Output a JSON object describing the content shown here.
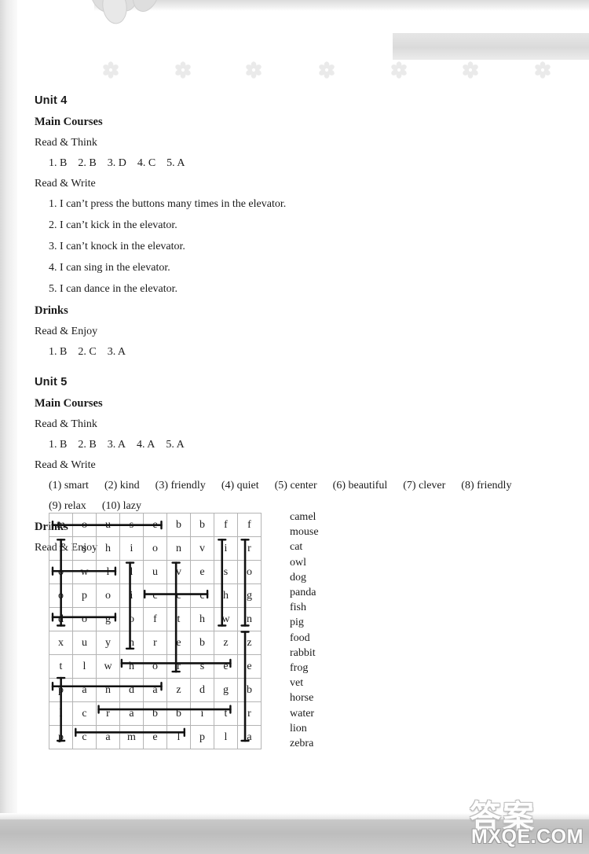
{
  "units": [
    {
      "title": "Unit 4",
      "sections": [
        {
          "kind": "section-head",
          "text": "Main Courses"
        },
        {
          "kind": "sub-head",
          "text": "Read & Think"
        },
        {
          "kind": "answers",
          "tokens": [
            "1. B",
            "2. B",
            "3. D",
            "4. C",
            "5. A"
          ]
        },
        {
          "kind": "sub-head",
          "text": "Read & Write"
        },
        {
          "kind": "sentence",
          "text": "1. I can’t press the buttons many times in the elevator."
        },
        {
          "kind": "sentence",
          "text": "2. I can’t kick in the elevator."
        },
        {
          "kind": "sentence",
          "text": "3. I can’t knock in the elevator."
        },
        {
          "kind": "sentence",
          "text": "4. I can sing in the elevator."
        },
        {
          "kind": "sentence",
          "text": "5. I can dance in the elevator."
        },
        {
          "kind": "section-head",
          "text": "Drinks"
        },
        {
          "kind": "sub-head",
          "text": "Read & Enjoy"
        },
        {
          "kind": "answers",
          "tokens": [
            "1. B",
            "2. C",
            "3. A"
          ]
        }
      ]
    },
    {
      "title": "Unit 5",
      "sections": [
        {
          "kind": "section-head",
          "text": "Main Courses"
        },
        {
          "kind": "sub-head",
          "text": "Read & Think"
        },
        {
          "kind": "answers",
          "tokens": [
            "1. B",
            "2. B",
            "3. A",
            "4. A",
            "5. A"
          ]
        },
        {
          "kind": "sub-head",
          "text": "Read & Write"
        },
        {
          "kind": "answers-wide",
          "tokens": [
            "(1) smart",
            "(2) kind",
            "(3) friendly",
            "(4) quiet",
            "(5) center",
            "(6) beautiful",
            "(7) clever",
            "(8) friendly"
          ]
        },
        {
          "kind": "answers-wide",
          "tokens": [
            "(9) relax",
            "(10) lazy"
          ]
        },
        {
          "kind": "section-head",
          "text": "Drinks"
        },
        {
          "kind": "sub-head",
          "text": "Read & Enjoy"
        }
      ]
    }
  ],
  "puzzle": {
    "rows": 10,
    "cols": 9,
    "grid": [
      [
        "m",
        "o",
        "u",
        "s",
        "e",
        "b",
        "b",
        "f",
        "f"
      ],
      [
        "f",
        "s",
        "h",
        "i",
        "o",
        "n",
        "v",
        "i",
        "r"
      ],
      [
        "o",
        "w",
        "l",
        "l",
        "u",
        "v",
        "e",
        "s",
        "o"
      ],
      [
        "o",
        "p",
        "o",
        "i",
        "c",
        "c",
        "c",
        "h",
        "g"
      ],
      [
        "d",
        "o",
        "g",
        "o",
        "f",
        "t",
        "h",
        "w",
        "n"
      ],
      [
        "x",
        "u",
        "y",
        "n",
        "r",
        "e",
        "b",
        "z",
        "z"
      ],
      [
        "t",
        "l",
        "w",
        "h",
        "o",
        "r",
        "s",
        "e",
        "e"
      ],
      [
        "p",
        "a",
        "n",
        "d",
        "a",
        "z",
        "d",
        "g",
        "b"
      ],
      [
        "l",
        "c",
        "r",
        "a",
        "b",
        "b",
        "i",
        "t",
        "r"
      ],
      [
        "p",
        "c",
        "a",
        "m",
        "e",
        "l",
        "p",
        "l",
        "a"
      ]
    ],
    "found_words": [
      {
        "word": "mouse",
        "row": 0,
        "col": 0,
        "dir": "h",
        "len": 5
      },
      {
        "word": "fish",
        "row": 1,
        "col": 7,
        "dir": "v",
        "len": 4
      },
      {
        "word": "frog",
        "row": 1,
        "col": 8,
        "dir": "v",
        "len": 4
      },
      {
        "word": "owl",
        "row": 2,
        "col": 0,
        "dir": "h",
        "len": 3
      },
      {
        "word": "food",
        "row": 1,
        "col": 0,
        "dir": "v",
        "len": 4
      },
      {
        "word": "cat",
        "row": 3,
        "col": 4,
        "dir": "h",
        "len": 3
      },
      {
        "word": "dog",
        "row": 4,
        "col": 0,
        "dir": "h",
        "len": 3
      },
      {
        "word": "lion",
        "row": 2,
        "col": 3,
        "dir": "v",
        "len": 4
      },
      {
        "word": "vet",
        "row": 2,
        "col": 5,
        "dir": "v",
        "len": 5
      },
      {
        "word": "horse",
        "row": 6,
        "col": 3,
        "dir": "h",
        "len": 5
      },
      {
        "word": "zebra",
        "row": 5,
        "col": 8,
        "dir": "v",
        "len": 5
      },
      {
        "word": "panda",
        "row": 7,
        "col": 0,
        "dir": "h",
        "len": 5
      },
      {
        "word": "pig",
        "row": 7,
        "col": 0,
        "dir": "v",
        "len": 3
      },
      {
        "word": "rabbit",
        "row": 8,
        "col": 2,
        "dir": "h",
        "len": 6
      },
      {
        "word": "camel",
        "row": 9,
        "col": 1,
        "dir": "h",
        "len": 5
      }
    ],
    "word_list": [
      "camel",
      "mouse",
      "cat",
      "owl",
      "dog",
      "panda",
      "fish",
      "pig",
      "food",
      "rabbit",
      "frog",
      "vet",
      "horse",
      "water",
      "lion",
      "zebra"
    ]
  },
  "watermark": {
    "cn_text": "答案",
    "url_text": "MXQE.COM"
  },
  "decor": {
    "flower_count": 7,
    "flower_color": "#bdbdbd",
    "petal_color": "#dcdcdc"
  },
  "colors": {
    "page_bg": "#ffffff",
    "ink": "#1a1a1a",
    "grid_line": "#b4b4b4",
    "strike": "#111111"
  }
}
